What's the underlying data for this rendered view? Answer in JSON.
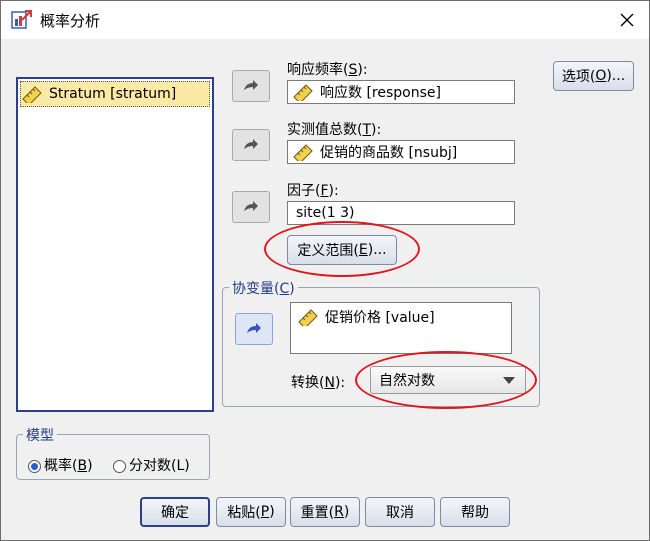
{
  "window": {
    "title": "概率分析"
  },
  "source_list": {
    "items": [
      "Stratum [stratum]"
    ]
  },
  "response": {
    "label_main": "响应频率(",
    "label_key": "S",
    "label_end": "):",
    "value": "响应数 [response]"
  },
  "observed": {
    "label_main": "实测值总数(",
    "label_key": "T",
    "label_end": "):",
    "value": "促销的商品数 [nsubj]"
  },
  "factor": {
    "label_main": "因子(",
    "label_key": "F",
    "label_end": "):",
    "value": "site(1 3)",
    "define_range_main": "定义范围(",
    "define_range_key": "E",
    "define_range_end": ")..."
  },
  "options_button": {
    "main": "选项(",
    "key": "O",
    "end": ")..."
  },
  "covariates": {
    "title_main": "协变量(",
    "title_key": "C",
    "title_end": ")",
    "items": [
      "促销价格 [value]"
    ],
    "transform_main": "转换(",
    "transform_key": "N",
    "transform_end": "):",
    "transform_value": "自然对数"
  },
  "model": {
    "title": "模型",
    "option1_main": "概率(",
    "option1_key": "B",
    "option1_end": ")",
    "option2": "分对数(L)"
  },
  "buttons": {
    "ok": "确定",
    "paste_main": "粘贴(",
    "paste_key": "P",
    "paste_end": ")",
    "reset_main": "重置(",
    "reset_key": "R",
    "reset_end": ")",
    "cancel": "取消",
    "help": "帮助"
  },
  "colors": {
    "highlight": "#fbe9a6",
    "annotation": "#e0161c",
    "accent": "#2b3f8f"
  }
}
